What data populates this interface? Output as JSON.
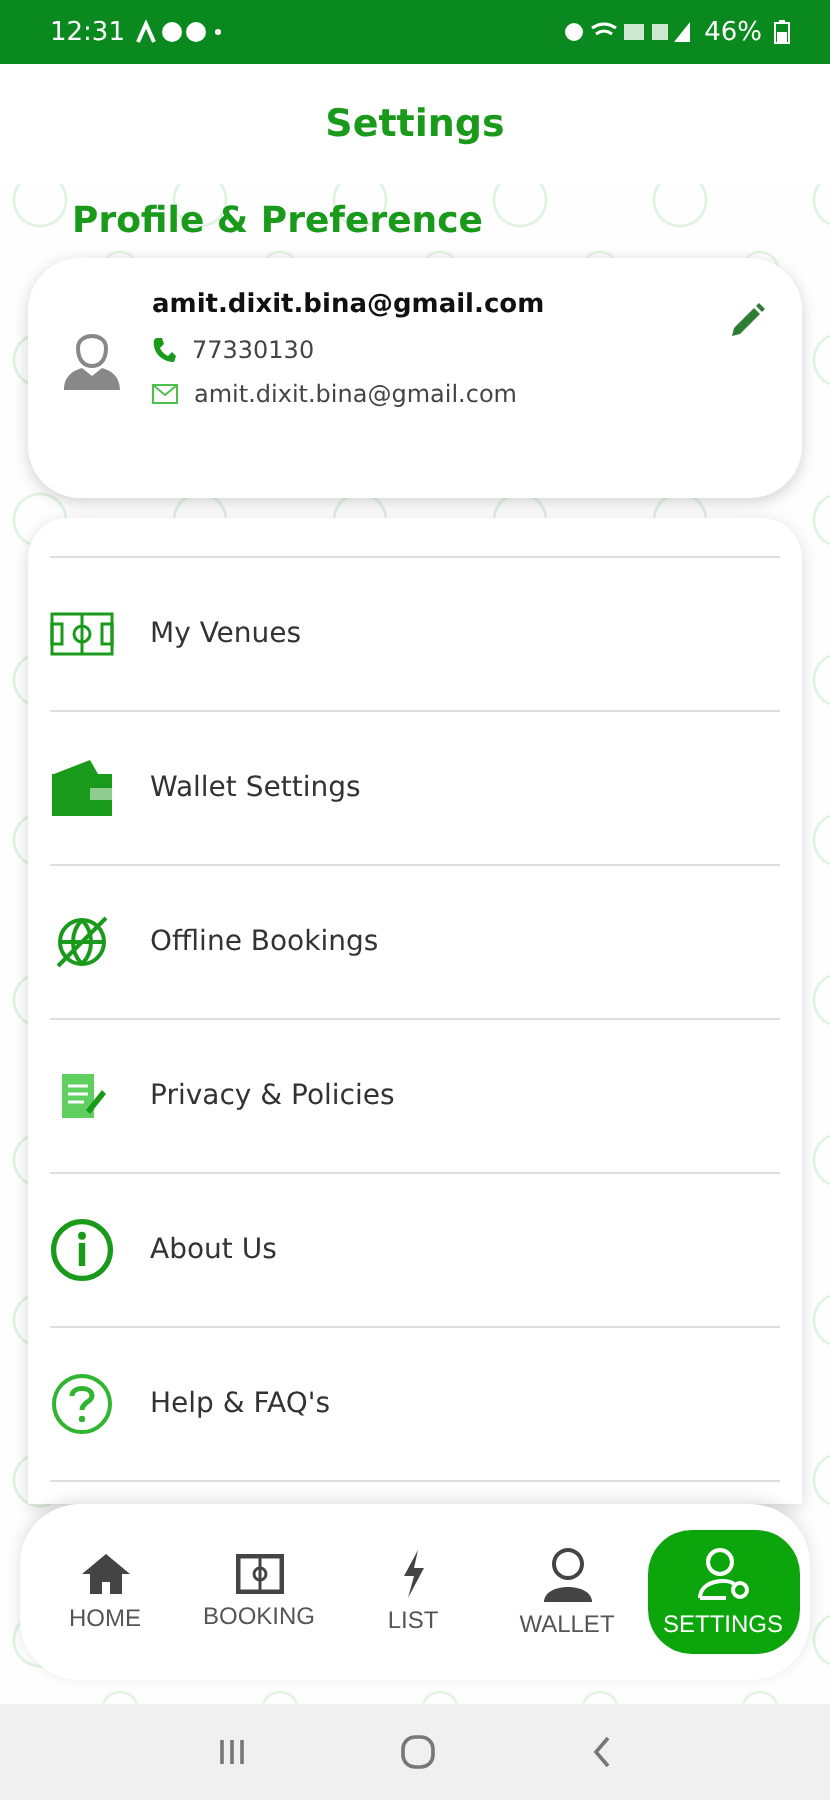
{
  "status_bar": {
    "time": "12:31",
    "battery": "46%"
  },
  "header": {
    "title": "Settings"
  },
  "profile": {
    "section_title": "Profile & Preference",
    "name": "amit.dixit.bina@gmail.com",
    "phone": "77330130",
    "email": "amit.dixit.bina@gmail.com"
  },
  "menu": [
    {
      "kind": "venues",
      "label": "My Venues"
    },
    {
      "kind": "wallet",
      "label": "Wallet Settings"
    },
    {
      "kind": "offline",
      "label": "Offline Bookings"
    },
    {
      "kind": "policy",
      "label": "Privacy & Policies"
    },
    {
      "kind": "info",
      "label": "About Us"
    },
    {
      "kind": "help",
      "label": "Help & FAQ's"
    }
  ],
  "tabs": [
    {
      "kind": "home",
      "label": "HOME",
      "selected": false
    },
    {
      "kind": "booking",
      "label": "BOOKING",
      "selected": false
    },
    {
      "kind": "list",
      "label": "LIST",
      "selected": false
    },
    {
      "kind": "wallet",
      "label": "WALLET",
      "selected": false
    },
    {
      "kind": "settings",
      "label": "SETTINGS",
      "selected": true
    }
  ]
}
